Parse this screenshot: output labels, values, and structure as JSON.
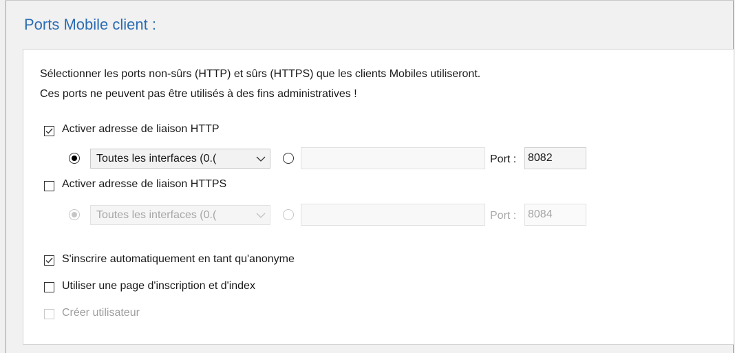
{
  "title": "Ports Mobile client :",
  "description": {
    "line1": "Sélectionner les ports non-sûrs (HTTP) et sûrs (HTTPS) que les clients Mobiles utiliseront.",
    "line2": "Ces ports ne peuvent pas être utilisés à des fins administratives !"
  },
  "http": {
    "label": "Activer adresse de liaison HTTP",
    "checked": true,
    "interface_selected": "Toutes les interfaces (0.(",
    "address_value": "",
    "port_label": "Port :",
    "port_value": "8082"
  },
  "https": {
    "label": "Activer adresse de liaison HTTPS",
    "checked": false,
    "interface_selected": "Toutes les interfaces (0.(",
    "address_value": "",
    "port_label": "Port :",
    "port_value": "8084"
  },
  "options": {
    "auto_anonymous": {
      "label": "S'inscrire automatiquement en tant qu'anonyme",
      "checked": true
    },
    "login_page": {
      "label": "Utiliser une page d'inscription et d'index",
      "checked": false
    },
    "create_user": {
      "label": "Créer utilisateur",
      "checked": false,
      "disabled": true
    }
  },
  "colors": {
    "title": "#2a6db3",
    "disabled_text": "#9d9d9d"
  },
  "icons": [
    "checkbox-check-icon",
    "chevron-down-icon",
    "radio-dot-icon"
  ]
}
